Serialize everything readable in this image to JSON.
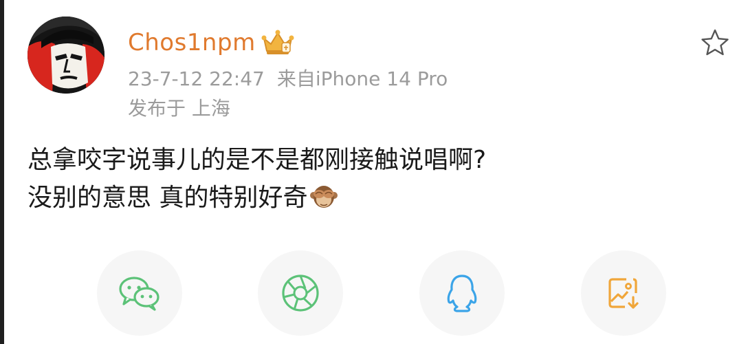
{
  "user": {
    "name": "Chos1npm",
    "badge_icon": "crown-badge-icon"
  },
  "meta": {
    "date": "23-7-12 22:47",
    "source": "来自iPhone 14 Pro",
    "location": "发布于 上海"
  },
  "post": {
    "line1": "总拿咬字说事儿的是不是都刚接触说唱啊?",
    "line2": "没别的意思 真的特别好奇",
    "emoji": "see-no-evil-monkey-icon"
  },
  "share": {
    "buttons": [
      {
        "icon": "wechat-icon",
        "color": "#5cc278"
      },
      {
        "icon": "moments-icon",
        "color": "#5cc278"
      },
      {
        "icon": "qq-icon",
        "color": "#3ba4e8"
      },
      {
        "icon": "save-image-icon",
        "color": "#f0a63a"
      }
    ]
  },
  "colors": {
    "username": "#e07a2e",
    "meta": "#9b9b9b",
    "text": "#1a1a1a"
  }
}
